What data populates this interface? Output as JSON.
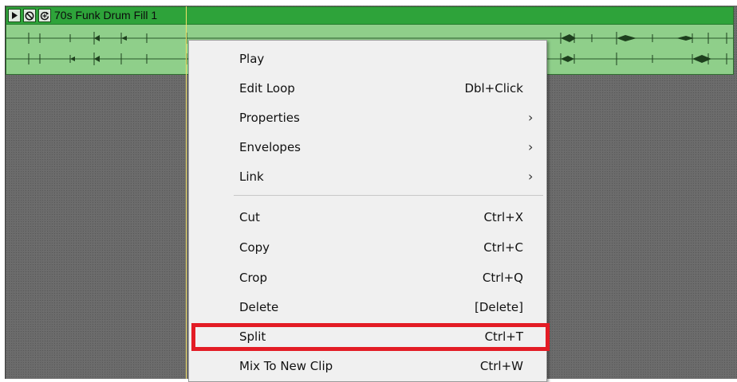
{
  "clip": {
    "title": "70s Funk Drum Fill 1",
    "buttons": {
      "play_icon": "play-triangle-icon",
      "mute_icon": "no-symbol-icon",
      "loop_icon": "loop-plus-icon"
    }
  },
  "context_menu": {
    "items": [
      {
        "label": "Play",
        "shortcut": "",
        "submenu": false
      },
      {
        "label": "Edit Loop",
        "shortcut": "Dbl+Click",
        "submenu": false
      },
      {
        "label": "Properties",
        "shortcut": "",
        "submenu": true
      },
      {
        "label": "Envelopes",
        "shortcut": "",
        "submenu": true
      },
      {
        "label": "Link",
        "shortcut": "",
        "submenu": true
      },
      {
        "label": "Cut",
        "shortcut": "Ctrl+X",
        "submenu": false
      },
      {
        "label": "Copy",
        "shortcut": "Ctrl+C",
        "submenu": false
      },
      {
        "label": "Crop",
        "shortcut": "Ctrl+Q",
        "submenu": false
      },
      {
        "label": "Delete",
        "shortcut": "[Delete]",
        "submenu": false
      },
      {
        "label": "Split",
        "shortcut": "Ctrl+T",
        "submenu": false
      },
      {
        "label": "Mix To New Clip",
        "shortcut": "Ctrl+W",
        "submenu": false
      }
    ],
    "submenu_arrow": "›",
    "highlighted_item": "Split"
  },
  "colors": {
    "clip_header": "#2ea33a",
    "clip_body": "#8fcf8a",
    "track_bg": "#6b6b6b",
    "menu_bg": "#f0f0f0",
    "highlight": "#e31c25"
  }
}
